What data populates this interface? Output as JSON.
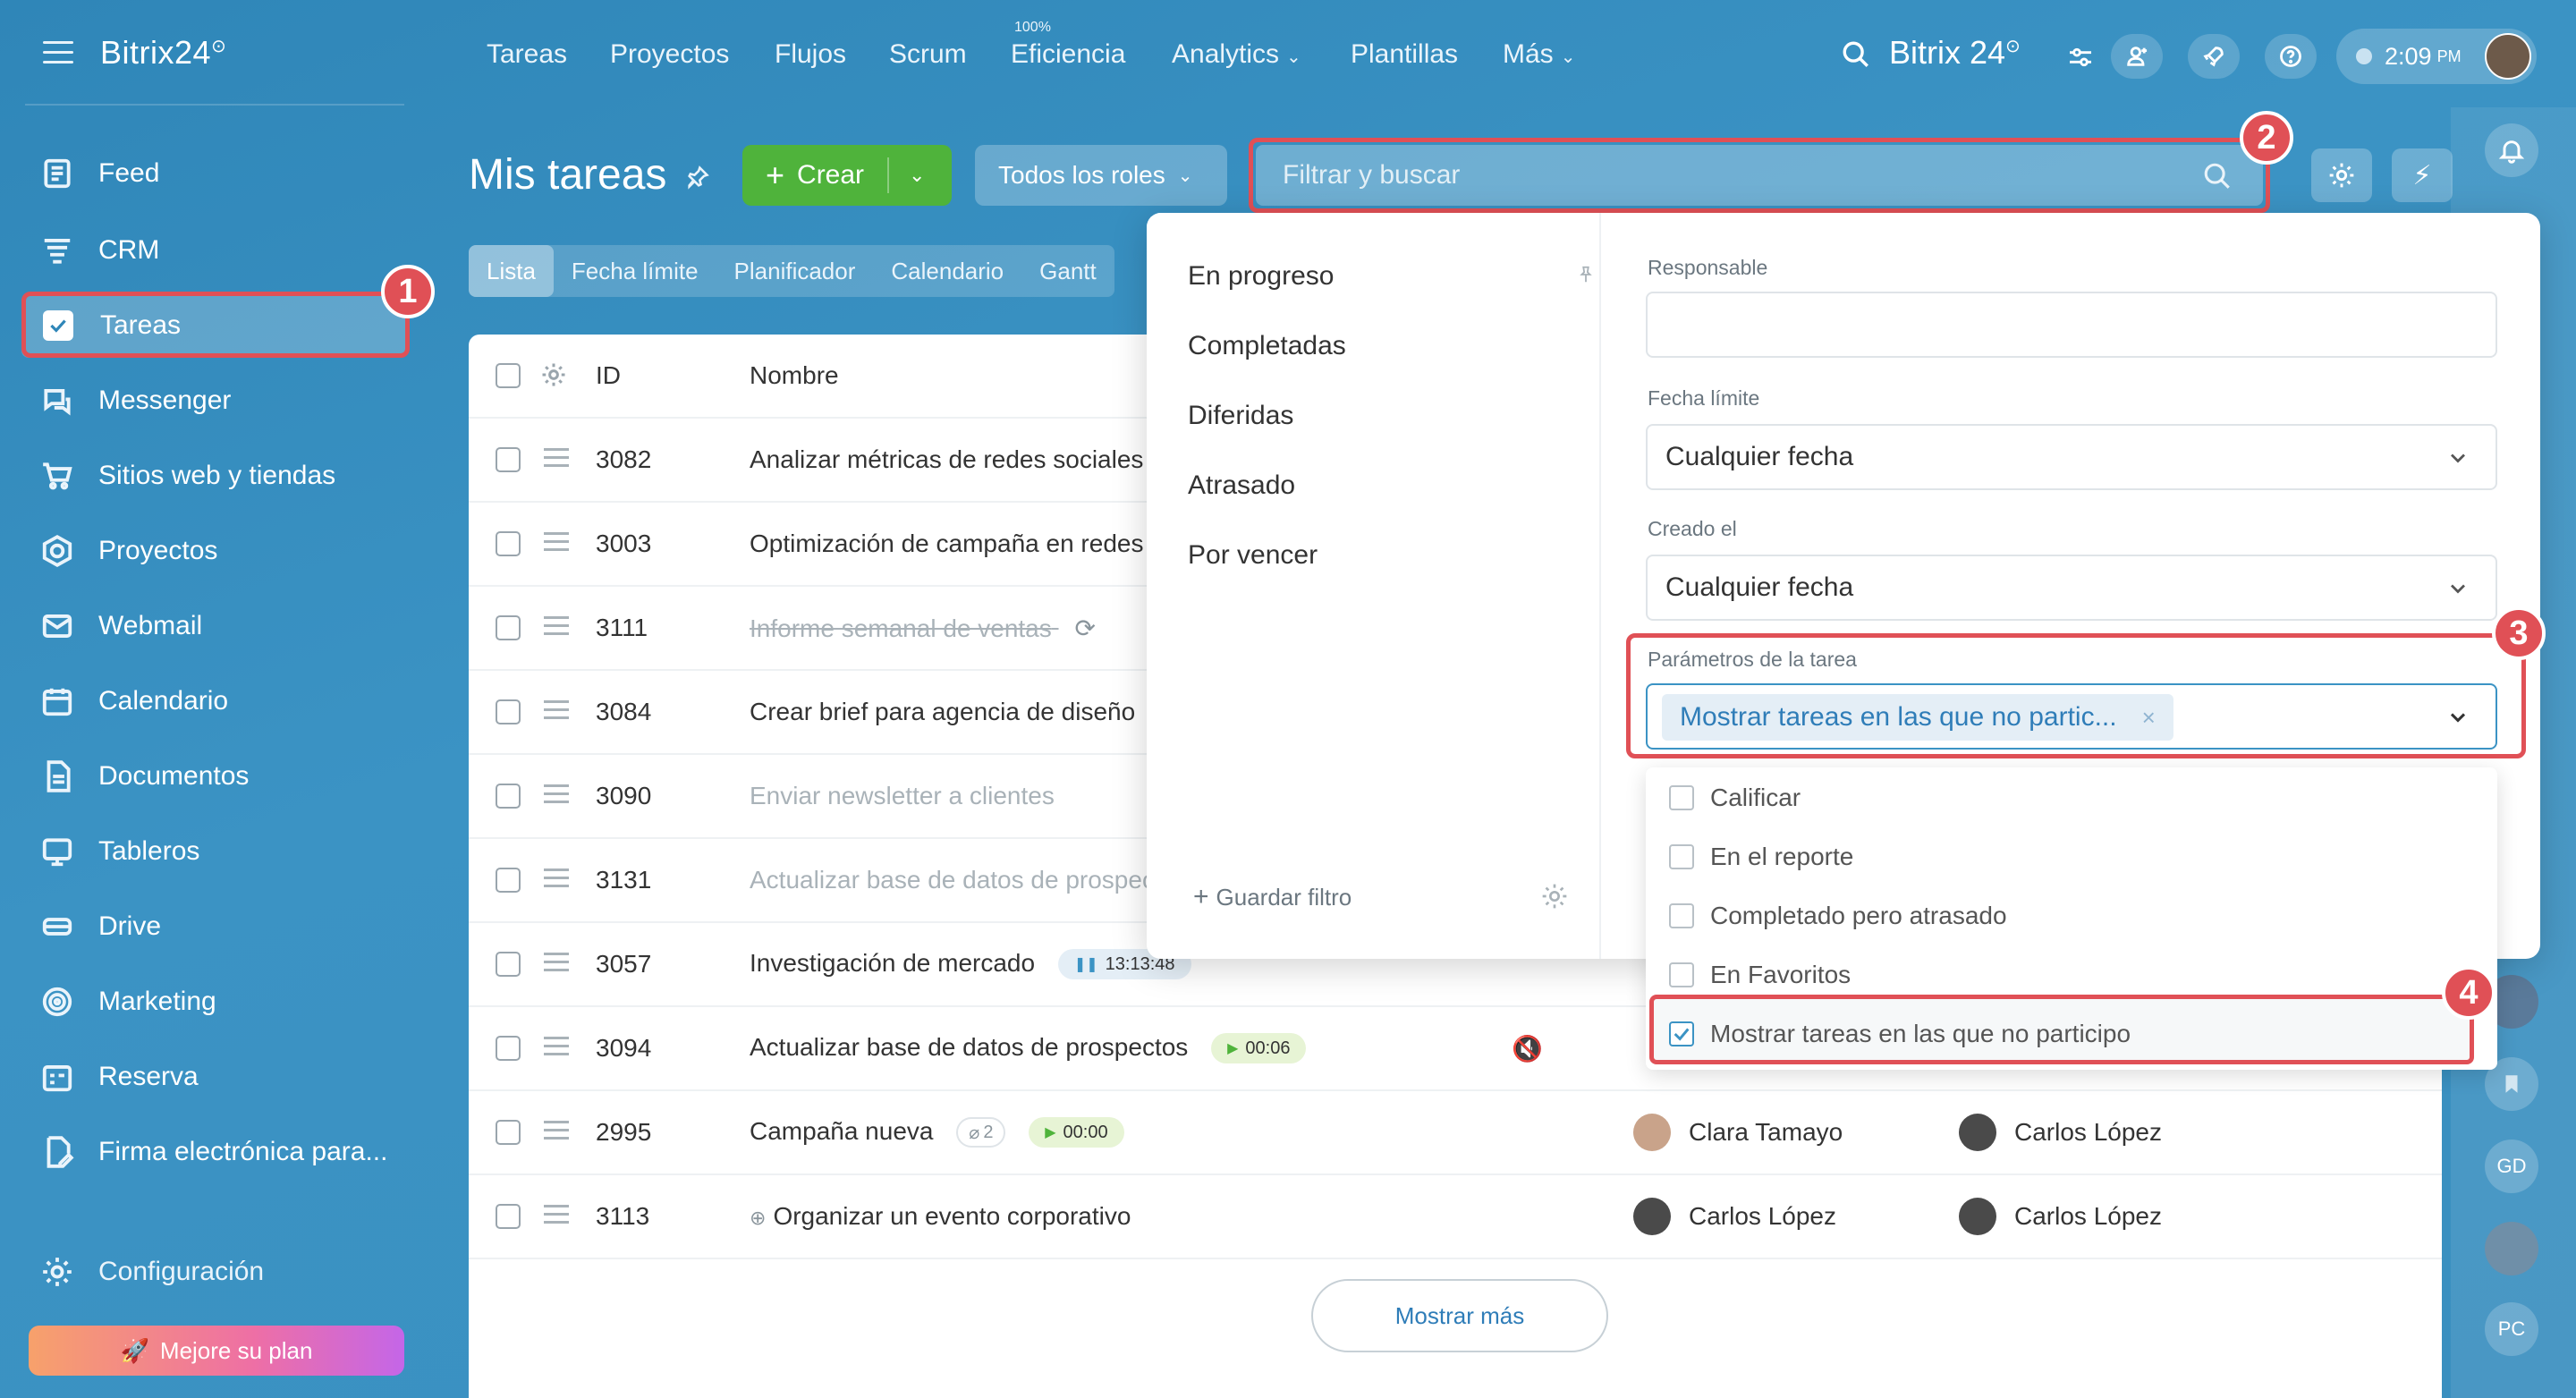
{
  "sidebar": {
    "brand": "Bitrix24",
    "brand_mark": "⊙",
    "items": [
      {
        "label": "Feed",
        "icon": "feed-icon"
      },
      {
        "label": "CRM",
        "icon": "crm-icon"
      },
      {
        "label": "Tareas",
        "icon": "tasks-icon"
      },
      {
        "label": "Messenger",
        "icon": "messenger-icon"
      },
      {
        "label": "Sitios web y tiendas",
        "icon": "cart-icon"
      },
      {
        "label": "Proyectos",
        "icon": "projects-icon"
      },
      {
        "label": "Webmail",
        "icon": "mail-icon"
      },
      {
        "label": "Calendario",
        "icon": "calendar-icon"
      },
      {
        "label": "Documentos",
        "icon": "document-icon"
      },
      {
        "label": "Tableros",
        "icon": "boards-icon"
      },
      {
        "label": "Drive",
        "icon": "drive-icon"
      },
      {
        "label": "Marketing",
        "icon": "marketing-icon"
      },
      {
        "label": "Reserva",
        "icon": "booking-icon"
      },
      {
        "label": "Firma electrónica para...",
        "icon": "signature-icon"
      }
    ],
    "settings_label": "Configuración",
    "upgrade_label": "Mejore su plan"
  },
  "topbar": {
    "nav": [
      {
        "label": "Tareas"
      },
      {
        "label": "Proyectos"
      },
      {
        "label": "Flujos"
      },
      {
        "label": "Scrum"
      },
      {
        "label": "Eficiencia"
      },
      {
        "label": "Analytics"
      },
      {
        "label": "Plantillas"
      },
      {
        "label": "Más"
      }
    ],
    "efficiency_badge": "100%",
    "brand": "Bitrix 24",
    "brand_mark": "⊙",
    "time": "2:09",
    "ampm": "PM"
  },
  "header": {
    "title": "Mis tareas",
    "create_label": "Crear",
    "roles_label": "Todos los roles",
    "search_placeholder": "Filtrar y buscar"
  },
  "view_tabs": [
    {
      "label": "Lista"
    },
    {
      "label": "Fecha límite"
    },
    {
      "label": "Planificador"
    },
    {
      "label": "Calendario"
    },
    {
      "label": "Gantt"
    }
  ],
  "table": {
    "col_id": "ID",
    "col_name": "Nombre",
    "rows": [
      {
        "id": "3082",
        "name": "Analizar métricas de redes sociales"
      },
      {
        "id": "3003",
        "name": "Optimización de campaña en redes"
      },
      {
        "id": "3111",
        "name": "Informe semanal de ventas"
      },
      {
        "id": "3084",
        "name": "Crear brief para agencia de diseño"
      },
      {
        "id": "3090",
        "name": "Enviar newsletter a clientes"
      },
      {
        "id": "3131",
        "name": "Actualizar base de datos de prospectos"
      },
      {
        "id": "3057",
        "name": "Investigación de mercado",
        "timer": "13:13:48"
      },
      {
        "id": "3094",
        "name": "Actualizar base de datos de prospectos",
        "timer": "00:06"
      },
      {
        "id": "2995",
        "name": "Campaña nueva",
        "attachments": "2",
        "timer": "00:00",
        "responsible": "Clara Tamayo",
        "creator": "Carlos López"
      },
      {
        "id": "3113",
        "name": "Organizar un evento corporativo",
        "responsible": "Carlos López",
        "creator": "Carlos López"
      }
    ],
    "more_label": "Mostrar más"
  },
  "filter_popup": {
    "presets": [
      {
        "label": "En progreso"
      },
      {
        "label": "Completadas"
      },
      {
        "label": "Diferidas"
      },
      {
        "label": "Atrasado"
      },
      {
        "label": "Por vencer"
      }
    ],
    "save_filter_label": "Guardar filtro",
    "fields": {
      "responsible_label": "Responsable",
      "responsible_value": "",
      "deadline_label": "Fecha límite",
      "deadline_value": "Cualquier fecha",
      "created_label": "Creado el",
      "created_value": "Cualquier fecha",
      "params_label": "Parámetros de la tarea",
      "params_chip": "Mostrar tareas en las que no partic..."
    },
    "options": [
      {
        "label": "Calificar",
        "checked": false
      },
      {
        "label": "En el reporte",
        "checked": false
      },
      {
        "label": "Completado pero atrasado",
        "checked": false
      },
      {
        "label": "En Favoritos",
        "checked": false
      },
      {
        "label": "Mostrar tareas en las que no participo",
        "checked": true
      }
    ]
  },
  "rail": {
    "initials_1": "GD",
    "initials_2": "PC"
  },
  "callouts": [
    "1",
    "2",
    "3",
    "4"
  ],
  "colors": {
    "accent": "#3b93c4",
    "create_green": "#4fb33b",
    "callout_red": "#e05056"
  }
}
